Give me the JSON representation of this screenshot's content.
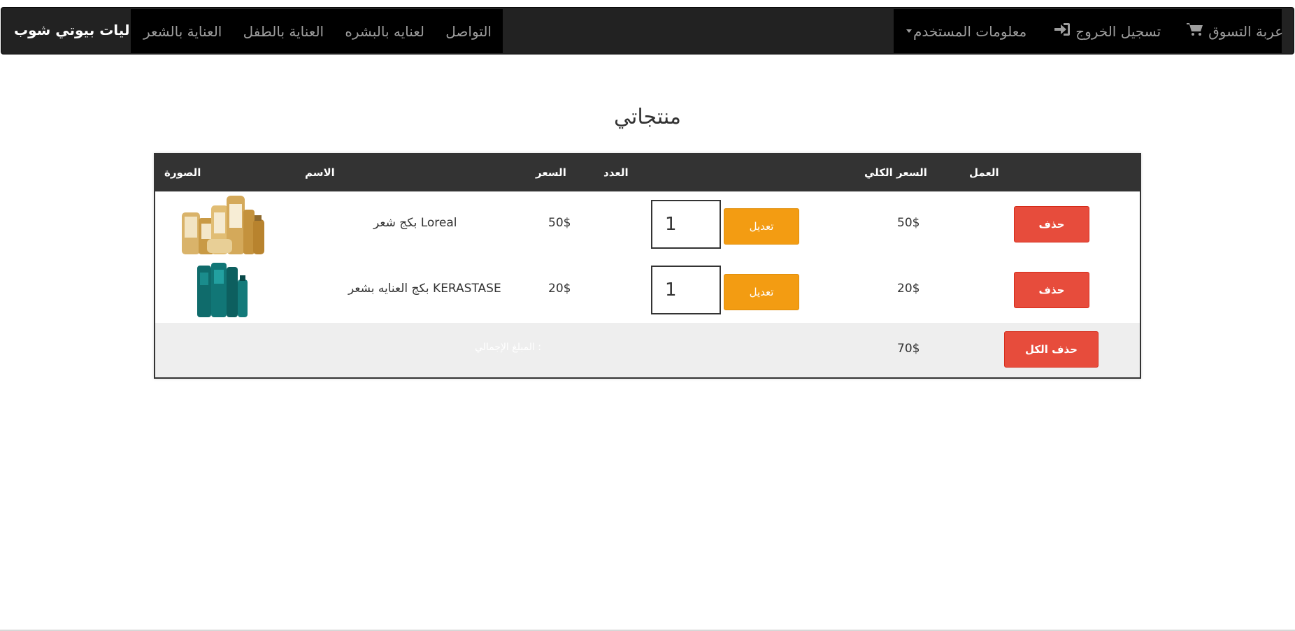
{
  "navbar": {
    "brand": "جماليات بيوتي شوب",
    "links": [
      "العناية بالشعر",
      "العناية بالطفل",
      "لعنايه بالبشره",
      "التواصل"
    ],
    "user_menu": "معلومات المستخدم",
    "logout": "تسجيل الخروج",
    "cart": "عربة التسوق"
  },
  "page": {
    "title": "منتجاتي"
  },
  "table": {
    "headers": {
      "image": "الصورة",
      "name": "الاسم",
      "price": "السعر",
      "quantity": "العدد",
      "total": "السعر الكلي",
      "action": "العمل"
    },
    "rows": [
      {
        "name": "بكج شعر Loreal",
        "price": "50$",
        "quantity": "1",
        "edit_label": "تعديل",
        "total": "50$",
        "delete_label": "حذف"
      },
      {
        "name": "بكج العنايه بشعر KERASTASE",
        "price": "20$",
        "quantity": "1",
        "edit_label": "تعديل",
        "total": "20$",
        "delete_label": "حذف"
      }
    ],
    "footer": {
      "total_label": "المبلغ الإجمالي :",
      "total_value": "70$",
      "delete_all_label": "حذف الكل"
    }
  },
  "colors": {
    "navbar_bg": "#222222",
    "nav_highlight_bg": "#000000",
    "edit_button": "#f39c12",
    "delete_button": "#e74c3c",
    "table_header": "#333333"
  }
}
